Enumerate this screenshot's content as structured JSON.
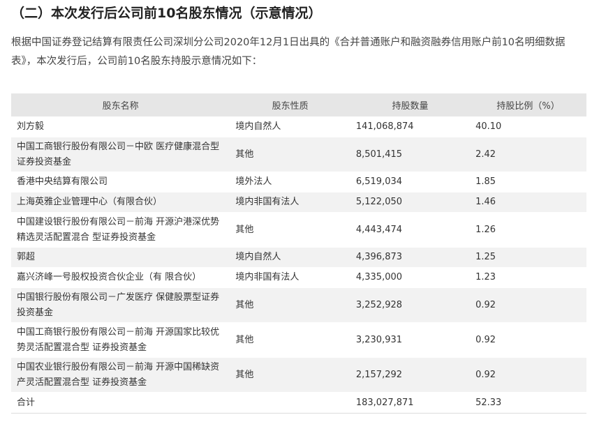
{
  "heading": "（二）本次发行后公司前10名股东情况（示意情况）",
  "intro": "根据中国证券登记结算有限责任公司深圳分公司2020年12月1日出具的《合并普通账户和融资融券信用账户前10名明细数据表》，本次发行后，公司前10名股东持股示意情况如下：",
  "table": {
    "headers": [
      "股东名称",
      "股东性质",
      "持股数量",
      "持股比例（%）"
    ],
    "rows": [
      {
        "name_lines": [
          "刘方毅"
        ],
        "type": "境内自然人",
        "qty": "141,068,874",
        "pct": "40.10"
      },
      {
        "name_lines": [
          "中国工商银行股份有限公司－中欧 医疗健康混合型",
          "证券投资基金"
        ],
        "type": "其他",
        "qty": "8,501,415",
        "pct": "2.42"
      },
      {
        "name_lines": [
          "香港中央结算有限公司"
        ],
        "type": "境外法人",
        "qty": "6,519,034",
        "pct": "1.85"
      },
      {
        "name_lines": [
          "上海英雅企业管理中心（有限合伙）"
        ],
        "type": "境内非国有法人",
        "qty": "5,122,050",
        "pct": "1.46"
      },
      {
        "name_lines": [
          "中国建设银行股份有限公司－前海 开源沪港深优势",
          "精选灵活配置混合 型证券投资基金"
        ],
        "type": "其他",
        "qty": "4,443,474",
        "pct": "1.26"
      },
      {
        "name_lines": [
          "郭超"
        ],
        "type": "境内自然人",
        "qty": "4,396,873",
        "pct": "1.25"
      },
      {
        "name_lines": [
          "嘉兴济峰一号股权投资合伙企业（有 限合伙）"
        ],
        "type": "境内非国有法人",
        "qty": "4,335,000",
        "pct": "1.23"
      },
      {
        "name_lines": [
          "中国银行股份有限公司－广发医疗 保健股票型证券",
          "投资基金"
        ],
        "type": "其他",
        "qty": "3,252,928",
        "pct": "0.92"
      },
      {
        "name_lines": [
          "中国工商银行股份有限公司－前海 开源国家比较优",
          "势灵活配置混合型 证券投资基金"
        ],
        "type": "其他",
        "qty": "3,230,931",
        "pct": "0.92"
      },
      {
        "name_lines": [
          "中国农业银行股份有限公司－前海 开源中国稀缺资",
          "产灵活配置混合型 证券投资基金"
        ],
        "type": "其他",
        "qty": "2,157,292",
        "pct": "0.92"
      }
    ],
    "total": {
      "name": "合计",
      "type": "",
      "qty": "183,027,871",
      "pct": "52.33"
    }
  }
}
